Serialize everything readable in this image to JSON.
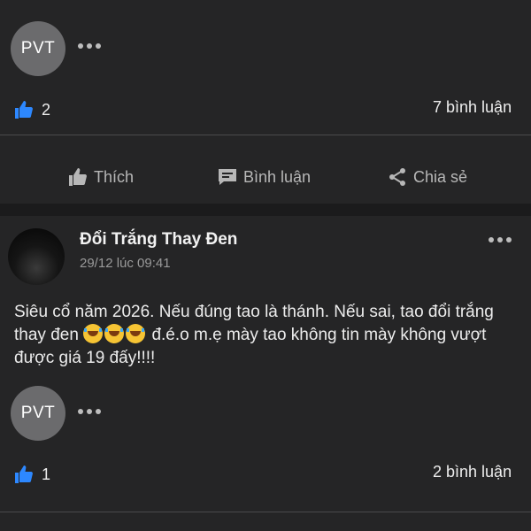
{
  "post_top": {
    "avatar_initials": "PVT",
    "like_count": "2",
    "comment_count": "7 bình luận"
  },
  "actions": {
    "like_label": "Thích",
    "comment_label": "Bình luận",
    "share_label": "Chia sẻ"
  },
  "post_main": {
    "author": "Đổi Trắng Thay Đen",
    "timestamp": "29/12 lúc 09:41",
    "text_part1": "Siêu cổ năm 2026. Nếu đúng tao là thánh. Nếu sai, tao đổi trắng thay đen ",
    "text_part2": " đ.é.o m.ẹ mày tao không tin mày không vượt được giá 19 đấy!!!!",
    "emoji": "laughing-tears-emoji"
  },
  "post_bottom": {
    "avatar_initials": "PVT",
    "like_count": "1",
    "comment_count": "2 bình luận"
  },
  "colors": {
    "background": "#252526",
    "like_blue": "#2d88ff",
    "avatar_gray": "#6b6b6d"
  }
}
